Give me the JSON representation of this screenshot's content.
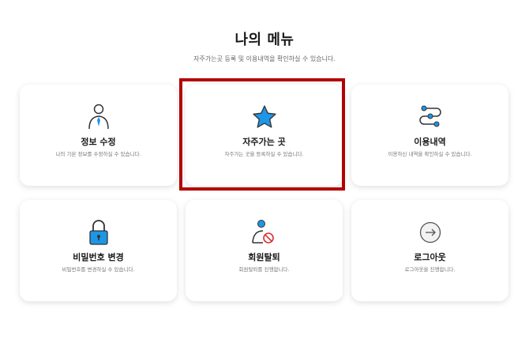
{
  "page": {
    "title": "나의 메뉴",
    "subtitle": "자주가는곳 등록 및 이용내역을 확인하실 수 있습니다."
  },
  "colors": {
    "accent": "#1e96e6",
    "highlight": "#b30000"
  },
  "menu": {
    "items": [
      {
        "icon": "person-tie-icon",
        "label": "정보 수정",
        "desc": "나의 기본 정보를 수정하실 수 있습니다."
      },
      {
        "icon": "star-icon",
        "label": "자주가는 곳",
        "desc": "자주가는 곳을 등록하실 수 있습니다."
      },
      {
        "icon": "route-icon",
        "label": "이용내역",
        "desc": "이용하신 내역을 확인하실 수 있습니다."
      },
      {
        "icon": "lock-icon",
        "label": "비밀번호 변경",
        "desc": "비밀번호를 변경하실 수 있습니다."
      },
      {
        "icon": "user-block-icon",
        "label": "회원탈퇴",
        "desc": "회원탈퇴를 진행합니다."
      },
      {
        "icon": "arrow-circle-icon",
        "label": "로그아웃",
        "desc": "로그아웃을 진행합니다."
      }
    ]
  }
}
